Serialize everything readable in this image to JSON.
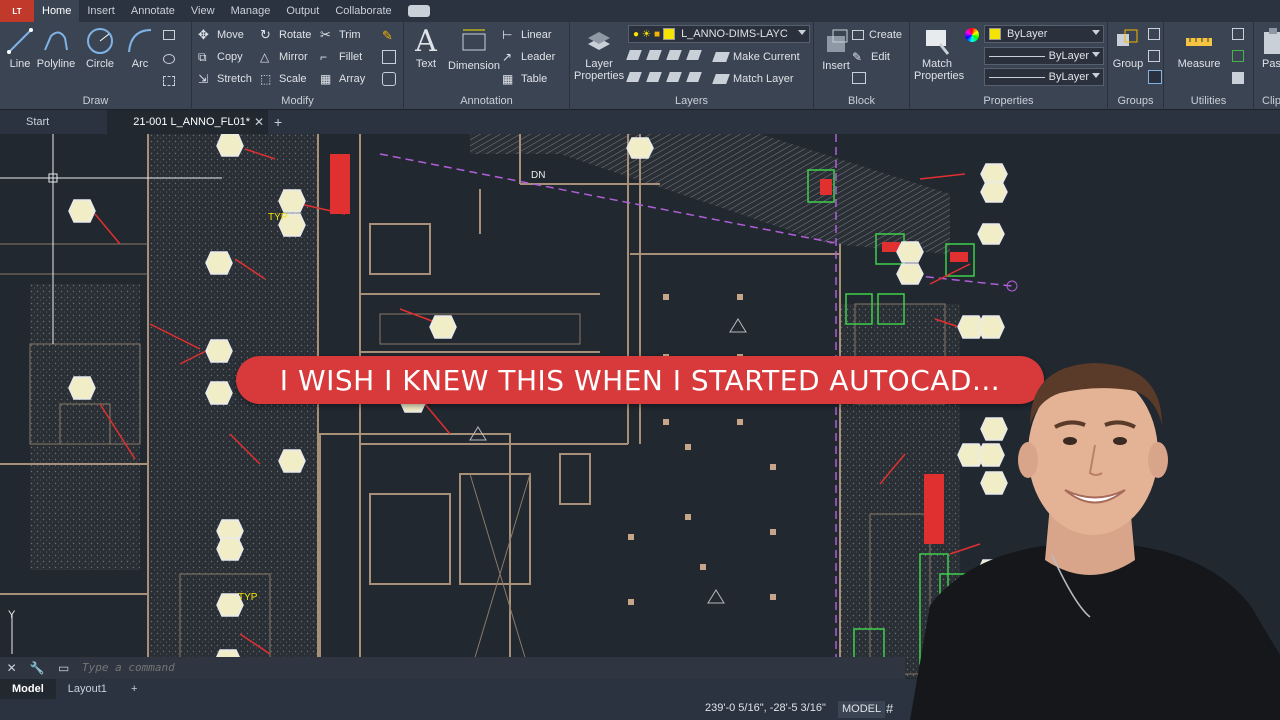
{
  "app": {
    "badge": "LT"
  },
  "menu_tabs": [
    "Home",
    "Insert",
    "Annotate",
    "View",
    "Manage",
    "Output",
    "Collaborate"
  ],
  "ribbon": {
    "draw": {
      "title": "Draw",
      "tools": [
        "Line",
        "Polyline",
        "Circle",
        "Arc"
      ]
    },
    "modify": {
      "title": "Modify",
      "tools": [
        "Move",
        "Rotate",
        "Trim",
        "Copy",
        "Mirror",
        "Fillet",
        "Stretch",
        "Scale",
        "Array"
      ]
    },
    "annotation": {
      "title": "Annotation",
      "big_tools": [
        "Text",
        "Dimension"
      ],
      "tools": [
        "Linear",
        "Leader",
        "Table"
      ]
    },
    "layers": {
      "title": "Layers",
      "big_tool": "Layer Properties",
      "current_layer": "L_ANNO-DIMS-LAYC",
      "tools": [
        "Make Current",
        "Match Layer"
      ]
    },
    "block": {
      "title": "Block",
      "big_tool": "Insert",
      "tools": [
        "Create",
        "Edit"
      ]
    },
    "properties": {
      "title": "Properties",
      "big_tool": "Match Properties",
      "color": "ByLayer",
      "linetype": "ByLayer",
      "lineweight": "ByLayer"
    },
    "groups": {
      "title": "Groups",
      "big_tool": "Group"
    },
    "utilities": {
      "title": "Utilities",
      "big_tool": "Measure"
    },
    "clipboard": {
      "title": "Clip",
      "big_tool": "Past"
    }
  },
  "file_tabs": {
    "start": "Start",
    "active": "21-001 L_ANNO_FL01*"
  },
  "drawing": {
    "labels": [
      "DN",
      "TYP",
      "TYP"
    ]
  },
  "command_line": {
    "placeholder": "Type a command"
  },
  "layout_tabs": [
    "Model",
    "Layout1"
  ],
  "status": {
    "coordinates": "239'-0 5/16\", -28'-5 3/16\"",
    "mode": "MODEL"
  },
  "thumbnail": {
    "banner_text": "I WISH I KNEW THIS WHEN I STARTED AUTOCAD..."
  },
  "colors": {
    "banner": "#d8393b",
    "ribbon": "#3b4453",
    "canvas": "#212830",
    "accent_layer": "#f5e400"
  }
}
